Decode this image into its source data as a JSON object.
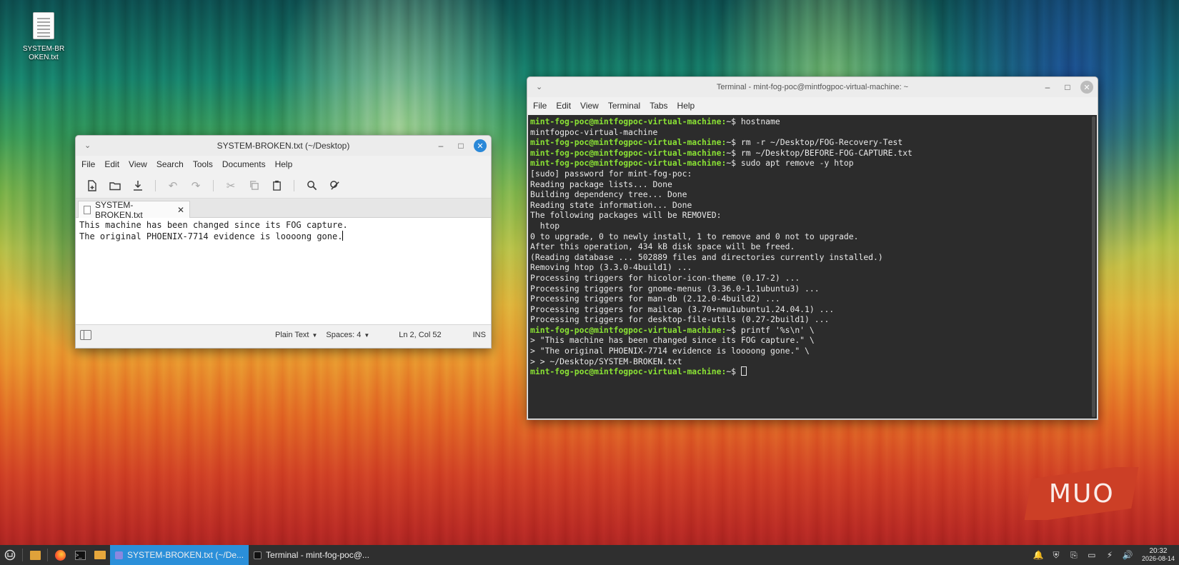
{
  "desktop": {
    "icon_label": "SYSTEM-BROKEN.txt"
  },
  "editor": {
    "title": "SYSTEM-BROKEN.txt (~/Desktop)",
    "menu": [
      "File",
      "Edit",
      "View",
      "Search",
      "Tools",
      "Documents",
      "Help"
    ],
    "toolbar_icons": [
      "new-document-icon",
      "open-icon",
      "save-icon",
      "undo-icon",
      "redo-icon",
      "cut-icon",
      "copy-icon",
      "paste-icon",
      "search-icon",
      "replace-icon"
    ],
    "tab_label": "SYSTEM-BROKEN.txt",
    "lines": [
      "This machine has been changed since its FOG capture.",
      "The original PHOENIX-7714 evidence is loooong gone."
    ],
    "status": {
      "language": "Plain Text",
      "spaces": "Spaces: 4",
      "position": "Ln 2, Col 52",
      "mode": "INS"
    }
  },
  "terminal": {
    "title": "Terminal - mint-fog-poc@mintfogpoc-virtual-machine: ~",
    "menu": [
      "File",
      "Edit",
      "View",
      "Terminal",
      "Tabs",
      "Help"
    ],
    "prompt": "mint-fog-poc@mintfogpoc-virtual-machine:",
    "prompt_suffix": "~$ ",
    "lines": [
      {
        "prompt": true,
        "text": "hostname"
      },
      {
        "prompt": false,
        "text": "mintfogpoc-virtual-machine"
      },
      {
        "prompt": true,
        "text": "rm -r ~/Desktop/FOG-Recovery-Test"
      },
      {
        "prompt": true,
        "text": "rm ~/Desktop/BEFORE-FOG-CAPTURE.txt"
      },
      {
        "prompt": true,
        "text": "sudo apt remove -y htop"
      },
      {
        "prompt": false,
        "text": "[sudo] password for mint-fog-poc:"
      },
      {
        "prompt": false,
        "text": "Reading package lists... Done"
      },
      {
        "prompt": false,
        "text": "Building dependency tree... Done"
      },
      {
        "prompt": false,
        "text": "Reading state information... Done"
      },
      {
        "prompt": false,
        "text": "The following packages will be REMOVED:"
      },
      {
        "prompt": false,
        "text": "  htop"
      },
      {
        "prompt": false,
        "text": "0 to upgrade, 0 to newly install, 1 to remove and 0 not to upgrade."
      },
      {
        "prompt": false,
        "text": "After this operation, 434 kB disk space will be freed."
      },
      {
        "prompt": false,
        "text": "(Reading database ... 502889 files and directories currently installed.)"
      },
      {
        "prompt": false,
        "text": "Removing htop (3.3.0-4build1) ..."
      },
      {
        "prompt": false,
        "text": "Processing triggers for hicolor-icon-theme (0.17-2) ..."
      },
      {
        "prompt": false,
        "text": "Processing triggers for gnome-menus (3.36.0-1.1ubuntu3) ..."
      },
      {
        "prompt": false,
        "text": "Processing triggers for man-db (2.12.0-4build2) ..."
      },
      {
        "prompt": false,
        "text": "Processing triggers for mailcap (3.70+nmu1ubuntu1.24.04.1) ..."
      },
      {
        "prompt": false,
        "text": "Processing triggers for desktop-file-utils (0.27-2build1) ..."
      },
      {
        "prompt": true,
        "text": "printf '%s\\n' \\"
      },
      {
        "prompt": false,
        "text": "> \"This machine has been changed since its FOG capture.\" \\"
      },
      {
        "prompt": false,
        "text": "> \"The original PHOENIX-7714 evidence is loooong gone.\" \\"
      },
      {
        "prompt": false,
        "text": "> > ~/Desktop/SYSTEM-BROKEN.txt"
      },
      {
        "prompt": true,
        "text": ""
      }
    ]
  },
  "watermark": "MUO",
  "taskbar": {
    "tasks": [
      {
        "label": "SYSTEM-BROKEN.txt (~/De...",
        "active": true
      },
      {
        "label": "Terminal - mint-fog-poc@...",
        "active": false
      }
    ],
    "clock_time": "20:32",
    "clock_date": "2026-08-14"
  },
  "colors": {
    "accent": "#2b8fd9",
    "prompt_green": "#8ae234",
    "terminal_bg": "#2c2c2c",
    "muo_red": "#cc3f26"
  }
}
